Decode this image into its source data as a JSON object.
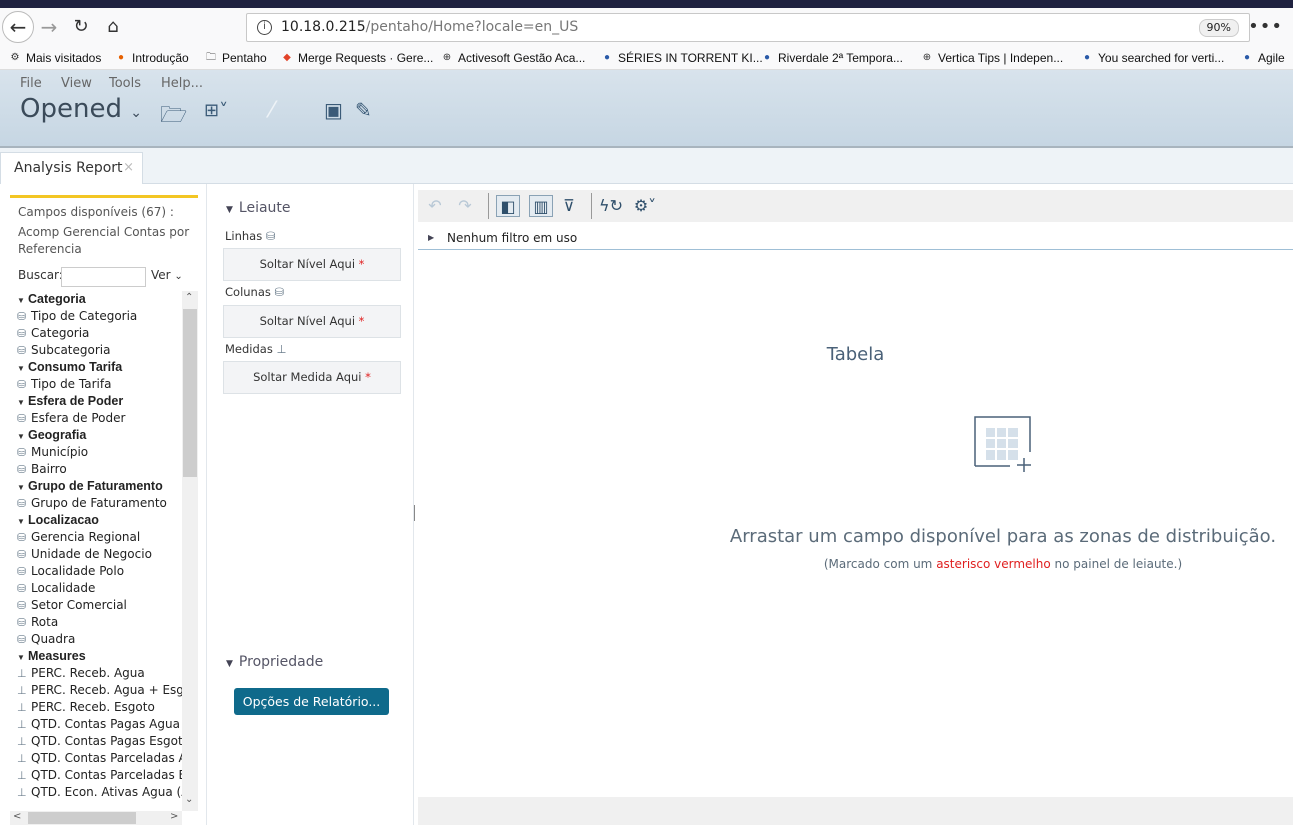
{
  "browser": {
    "url_host": "10.18.0.215",
    "url_path": "/pentaho/Home?locale=en_US",
    "zoom": "90%",
    "bookmarks": [
      {
        "label": "Mais visitados",
        "icon": "gear-icon"
      },
      {
        "label": "Introdução",
        "icon": "firefox-icon"
      },
      {
        "label": "Pentaho",
        "icon": "folder-icon"
      },
      {
        "label": "Merge Requests · Gere...",
        "icon": "gitlab-icon"
      },
      {
        "label": "Activesoft Gestão Aca...",
        "icon": "globe-icon"
      },
      {
        "label": "SÉRIES IN TORRENT KI...",
        "icon": "site-icon"
      },
      {
        "label": "Riverdale 2ª Tempora...",
        "icon": "site-icon"
      },
      {
        "label": "Vertica Tips | Indepen...",
        "icon": "globe-icon"
      },
      {
        "label": "You searched for verti...",
        "icon": "site-icon"
      },
      {
        "label": "Agile",
        "icon": "site-icon"
      }
    ]
  },
  "app": {
    "menu": [
      "File",
      "View",
      "Tools",
      "Help..."
    ],
    "perspective": "Opened",
    "tab_label": "Analysis Report"
  },
  "fields": {
    "title": "Campos disponíveis (67) :",
    "cube": "Acomp Gerencial Contas por Referencia",
    "search_label": "Buscar:",
    "search_value": "",
    "view_label": "Ver",
    "tree": [
      {
        "type": "group",
        "label": "Categoria"
      },
      {
        "type": "level",
        "label": "Tipo de Categoria"
      },
      {
        "type": "level",
        "label": "Categoria"
      },
      {
        "type": "level",
        "label": "Subcategoria"
      },
      {
        "type": "group",
        "label": "Consumo Tarifa"
      },
      {
        "type": "level",
        "label": "Tipo de Tarifa"
      },
      {
        "type": "group",
        "label": "Esfera de Poder"
      },
      {
        "type": "level",
        "label": "Esfera de Poder"
      },
      {
        "type": "group",
        "label": "Geografia"
      },
      {
        "type": "level",
        "label": "Município"
      },
      {
        "type": "level",
        "label": "Bairro"
      },
      {
        "type": "group",
        "label": "Grupo de Faturamento"
      },
      {
        "type": "level",
        "label": "Grupo de Faturamento"
      },
      {
        "type": "group",
        "label": "Localizacao"
      },
      {
        "type": "level",
        "label": "Gerencia Regional"
      },
      {
        "type": "level",
        "label": "Unidade de Negocio"
      },
      {
        "type": "level",
        "label": "Localidade Polo"
      },
      {
        "type": "level",
        "label": "Localidade"
      },
      {
        "type": "level",
        "label": "Setor Comercial"
      },
      {
        "type": "level",
        "label": "Rota"
      },
      {
        "type": "level",
        "label": "Quadra"
      },
      {
        "type": "group",
        "label": "Measures"
      },
      {
        "type": "measure",
        "label": "PERC. Receb. Agua"
      },
      {
        "type": "measure",
        "label": "PERC. Receb. Agua + Esgoto"
      },
      {
        "type": "measure",
        "label": "PERC. Receb. Esgoto"
      },
      {
        "type": "measure",
        "label": "QTD. Contas Pagas Agua"
      },
      {
        "type": "measure",
        "label": "QTD. Contas Pagas Esgoto"
      },
      {
        "type": "measure",
        "label": "QTD. Contas Parceladas Agua"
      },
      {
        "type": "measure",
        "label": "QTD. Contas Parceladas Esgoto"
      },
      {
        "type": "measure",
        "label": "QTD. Econ. Ativas Agua (Atual)"
      }
    ]
  },
  "layout": {
    "title": "Leiaute",
    "rows_label": "Linhas",
    "rows_drop": "Soltar Nível Aqui",
    "columns_label": "Colunas",
    "columns_drop": "Soltar Nível Aqui",
    "measures_label": "Medidas",
    "measures_drop": "Soltar Medida Aqui",
    "required_marker": "*",
    "properties_title": "Propriedade",
    "report_options": "Opções de Relatório..."
  },
  "report": {
    "filter_text": "Nenhum filtro em uso",
    "viz_title": "Tabela",
    "drag_text": "Arrastar um campo disponível para as zonas de distribuição.",
    "hint_pre": "(Marcado com um ",
    "hint_red": "asterisco vermelho",
    "hint_post": " no painel de leiaute.)"
  },
  "colors": {
    "accent": "#0f6a8b",
    "highlight": "#f3c623",
    "required": "#e02020"
  }
}
